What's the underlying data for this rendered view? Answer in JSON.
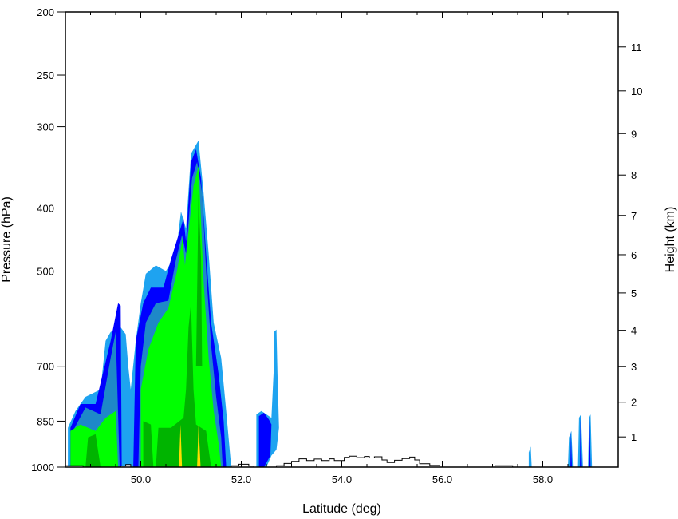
{
  "chart_data": {
    "type": "area",
    "xlabel": "Latitude (deg)",
    "ylabel": "Pressure (hPa)",
    "y2label": "Height (km)",
    "xlim": [
      48.5,
      59.5
    ],
    "ylim": [
      1000,
      200
    ],
    "y_scale": "log",
    "x_ticks": [
      50.0,
      52.0,
      54.0,
      56.0,
      58.0
    ],
    "x_tick_labels": [
      "50.0",
      "52.0",
      "54.0",
      "56.0",
      "58.0"
    ],
    "y_ticks": [
      200,
      250,
      300,
      400,
      500,
      700,
      850,
      1000
    ],
    "y_tick_labels": [
      "200",
      "250",
      "300",
      "400",
      "500",
      "700",
      "850",
      "1000"
    ],
    "y2_ticks": [
      1,
      2,
      3,
      4,
      5,
      6,
      7,
      8,
      9,
      10,
      11
    ],
    "y2_tick_labels": [
      "1",
      "2",
      "3",
      "4",
      "5",
      "6",
      "7",
      "8",
      "9",
      "10",
      "11"
    ],
    "grid": false,
    "colors": {
      "level1": "#1ea3f0",
      "level2": "#0000ff",
      "level3": "#1e88c8",
      "level4": "#00ff00",
      "level5": "#00b400",
      "level6": "#ffdd00",
      "terrain": "#000000"
    },
    "series": [
      {
        "level": "level1",
        "regions": [
          [
            [
              48.55,
              1000
            ],
            [
              48.55,
              870
            ],
            [
              48.7,
              820
            ],
            [
              48.9,
              780
            ],
            [
              49.2,
              760
            ],
            [
              49.3,
              640
            ],
            [
              49.4,
              620
            ],
            [
              49.6,
              610
            ],
            [
              49.7,
              625
            ],
            [
              49.75,
              700
            ],
            [
              49.8,
              760
            ],
            [
              49.9,
              640
            ],
            [
              50.0,
              560
            ],
            [
              50.1,
              505
            ],
            [
              50.3,
              490
            ],
            [
              50.5,
              500
            ],
            [
              50.7,
              470
            ],
            [
              50.8,
              405
            ],
            [
              50.9,
              430
            ],
            [
              51.0,
              330
            ],
            [
              51.15,
              315
            ],
            [
              51.25,
              380
            ],
            [
              51.35,
              470
            ],
            [
              51.45,
              600
            ],
            [
              51.6,
              680
            ],
            [
              51.7,
              820
            ],
            [
              51.78,
              960
            ],
            [
              51.8,
              1000
            ]
          ],
          [
            [
              52.3,
              1000
            ],
            [
              52.3,
              830
            ],
            [
              52.4,
              820
            ],
            [
              52.5,
              830
            ],
            [
              52.6,
              840
            ],
            [
              52.65,
              700
            ],
            [
              52.65,
              620
            ],
            [
              52.7,
              615
            ],
            [
              52.72,
              720
            ],
            [
              52.75,
              870
            ],
            [
              52.7,
              940
            ],
            [
              52.6,
              960
            ],
            [
              52.5,
              1000
            ]
          ],
          [
            [
              57.72,
              1000
            ],
            [
              57.72,
              950
            ],
            [
              57.76,
              930
            ],
            [
              57.78,
              1000
            ]
          ],
          [
            [
              58.5,
              1000
            ],
            [
              58.52,
              900
            ],
            [
              58.57,
              880
            ],
            [
              58.6,
              1000
            ]
          ],
          [
            [
              58.7,
              1000
            ],
            [
              58.72,
              840
            ],
            [
              58.76,
              830
            ],
            [
              58.8,
              1000
            ]
          ],
          [
            [
              58.9,
              1000
            ],
            [
              58.92,
              840
            ],
            [
              58.95,
              830
            ],
            [
              58.98,
              1000
            ]
          ]
        ]
      },
      {
        "level": "level2",
        "regions": [
          [
            [
              48.6,
              1000
            ],
            [
              48.6,
              870
            ],
            [
              48.8,
              800
            ],
            [
              49.1,
              800
            ],
            [
              49.4,
              640
            ],
            [
              49.55,
              560
            ],
            [
              49.6,
              565
            ],
            [
              49.62,
              1000
            ]
          ],
          [
            [
              49.85,
              1000
            ],
            [
              49.9,
              640
            ],
            [
              50.05,
              560
            ],
            [
              50.2,
              530
            ],
            [
              50.45,
              530
            ],
            [
              50.6,
              480
            ],
            [
              50.75,
              440
            ],
            [
              50.85,
              415
            ],
            [
              50.9,
              450
            ],
            [
              51.0,
              340
            ],
            [
              51.1,
              325
            ],
            [
              51.2,
              360
            ],
            [
              51.3,
              470
            ],
            [
              51.4,
              600
            ],
            [
              51.55,
              720
            ],
            [
              51.65,
              850
            ],
            [
              51.7,
              1000
            ]
          ],
          [
            [
              52.35,
              1000
            ],
            [
              52.35,
              835
            ],
            [
              52.45,
              825
            ],
            [
              52.55,
              845
            ],
            [
              52.6,
              860
            ],
            [
              52.58,
              960
            ],
            [
              52.45,
              1000
            ]
          ],
          [
            [
              58.55,
              1000
            ],
            [
              58.56,
              880
            ],
            [
              58.58,
              1000
            ]
          ],
          [
            [
              58.74,
              1000
            ],
            [
              58.75,
              840
            ],
            [
              58.78,
              1000
            ]
          ],
          [
            [
              58.92,
              1000
            ],
            [
              58.93,
              840
            ],
            [
              58.95,
              1000
            ]
          ]
        ]
      },
      {
        "level": "level3",
        "regions": [
          [
            [
              48.65,
              1000
            ],
            [
              48.65,
              880
            ],
            [
              48.9,
              810
            ],
            [
              49.2,
              830
            ],
            [
              49.4,
              680
            ],
            [
              49.5,
              620
            ],
            [
              49.58,
              1000
            ]
          ],
          [
            [
              49.95,
              1000
            ],
            [
              50.0,
              700
            ],
            [
              50.1,
              600
            ],
            [
              50.3,
              560
            ],
            [
              50.55,
              555
            ],
            [
              50.7,
              480
            ],
            [
              50.82,
              440
            ],
            [
              50.9,
              470
            ],
            [
              51.02,
              360
            ],
            [
              51.12,
              340
            ],
            [
              51.22,
              380
            ],
            [
              51.3,
              500
            ],
            [
              51.4,
              650
            ],
            [
              51.5,
              780
            ],
            [
              51.6,
              900
            ],
            [
              51.63,
              1000
            ]
          ]
        ]
      },
      {
        "level": "level4",
        "regions": [
          [
            [
              48.6,
              1000
            ],
            [
              48.6,
              880
            ],
            [
              48.8,
              860
            ],
            [
              49.1,
              880
            ],
            [
              49.3,
              840
            ],
            [
              49.5,
              820
            ],
            [
              49.55,
              1000
            ]
          ],
          [
            [
              50.0,
              1000
            ],
            [
              50.0,
              760
            ],
            [
              50.15,
              660
            ],
            [
              50.35,
              600
            ],
            [
              50.55,
              570
            ],
            [
              50.72,
              500
            ],
            [
              50.83,
              445
            ],
            [
              50.88,
              490
            ],
            [
              51.05,
              370
            ],
            [
              51.15,
              345
            ],
            [
              51.2,
              420
            ],
            [
              51.25,
              520
            ],
            [
              51.35,
              680
            ],
            [
              51.45,
              820
            ],
            [
              51.55,
              920
            ],
            [
              51.6,
              1000
            ]
          ]
        ]
      },
      {
        "level": "level5",
        "regions": [
          [
            [
              48.9,
              1000
            ],
            [
              48.95,
              900
            ],
            [
              49.1,
              890
            ],
            [
              49.2,
              1000
            ]
          ],
          [
            [
              50.3,
              1000
            ],
            [
              50.35,
              870
            ],
            [
              50.6,
              870
            ],
            [
              50.85,
              840
            ],
            [
              50.9,
              760
            ],
            [
              50.95,
              610
            ],
            [
              51.0,
              560
            ],
            [
              51.05,
              760
            ],
            [
              51.1,
              860
            ],
            [
              51.3,
              880
            ],
            [
              51.4,
              1000
            ]
          ],
          [
            [
              51.1,
              700
            ],
            [
              51.15,
              380
            ],
            [
              51.2,
              480
            ],
            [
              51.22,
              700
            ]
          ],
          [
            [
              50.05,
              1000
            ],
            [
              50.05,
              850
            ],
            [
              50.2,
              860
            ],
            [
              50.25,
              1000
            ]
          ]
        ]
      },
      {
        "level": "level6",
        "regions": [
          [
            [
              50.76,
              1000
            ],
            [
              50.79,
              860
            ],
            [
              50.82,
              1000
            ]
          ],
          [
            [
              51.12,
              1000
            ],
            [
              51.15,
              860
            ],
            [
              51.19,
              1000
            ]
          ]
        ]
      }
    ],
    "terrain_profile": [
      [
        48.5,
        1000
      ],
      [
        48.5,
        995
      ],
      [
        48.85,
        995
      ],
      [
        48.85,
        1000
      ],
      [
        49.6,
        1000
      ],
      [
        49.6,
        996
      ],
      [
        49.7,
        996
      ],
      [
        49.7,
        991
      ],
      [
        49.8,
        991
      ],
      [
        49.8,
        1000
      ],
      [
        51.8,
        1000
      ],
      [
        51.8,
        995
      ],
      [
        51.95,
        995
      ],
      [
        51.95,
        990
      ],
      [
        52.15,
        990
      ],
      [
        52.15,
        996
      ],
      [
        52.25,
        996
      ],
      [
        52.25,
        1000
      ],
      [
        52.7,
        1000
      ],
      [
        52.7,
        995
      ],
      [
        52.85,
        995
      ],
      [
        52.85,
        987
      ],
      [
        53.0,
        987
      ],
      [
        53.0,
        980
      ],
      [
        53.15,
        980
      ],
      [
        53.15,
        971
      ],
      [
        53.3,
        971
      ],
      [
        53.3,
        977
      ],
      [
        53.45,
        977
      ],
      [
        53.45,
        972
      ],
      [
        53.6,
        972
      ],
      [
        53.6,
        977
      ],
      [
        53.75,
        977
      ],
      [
        53.75,
        971
      ],
      [
        53.85,
        971
      ],
      [
        53.85,
        977
      ],
      [
        54.05,
        977
      ],
      [
        54.05,
        966
      ],
      [
        54.15,
        966
      ],
      [
        54.15,
        962
      ],
      [
        54.3,
        962
      ],
      [
        54.3,
        967
      ],
      [
        54.45,
        967
      ],
      [
        54.45,
        963
      ],
      [
        54.55,
        963
      ],
      [
        54.55,
        968
      ],
      [
        54.65,
        968
      ],
      [
        54.65,
        964
      ],
      [
        54.8,
        964
      ],
      [
        54.8,
        975
      ],
      [
        54.9,
        975
      ],
      [
        54.9,
        984
      ],
      [
        55.05,
        984
      ],
      [
        55.05,
        976
      ],
      [
        55.2,
        976
      ],
      [
        55.2,
        970
      ],
      [
        55.35,
        970
      ],
      [
        55.35,
        965
      ],
      [
        55.45,
        965
      ],
      [
        55.45,
        975
      ],
      [
        55.55,
        975
      ],
      [
        55.55,
        988
      ],
      [
        55.75,
        988
      ],
      [
        55.75,
        994
      ],
      [
        55.95,
        994
      ],
      [
        55.95,
        1000
      ],
      [
        57.05,
        1000
      ],
      [
        57.05,
        995
      ],
      [
        57.4,
        995
      ],
      [
        57.4,
        1000
      ],
      [
        59.5,
        1000
      ]
    ]
  }
}
